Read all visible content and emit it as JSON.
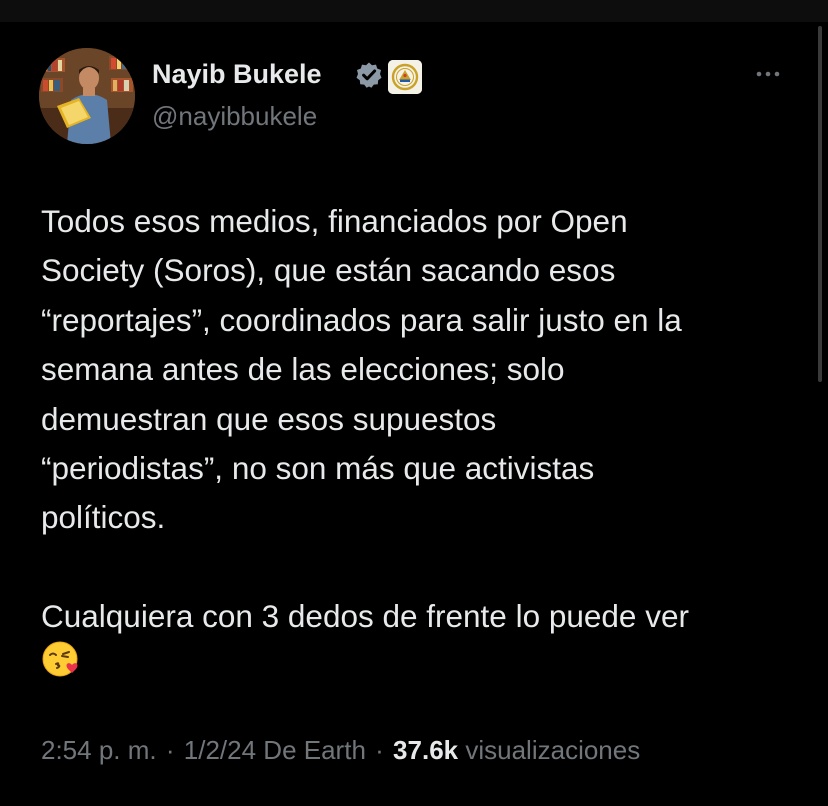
{
  "tweet": {
    "author": {
      "name": "Nayib Bukele",
      "handle": "@nayibbukele",
      "avatar": "avatar-photo",
      "verified_icon": "verified-badge-icon",
      "affiliation_icon": "el-salvador-coat-of-arms-icon"
    },
    "more_icon": "more-options-icon",
    "text": {
      "paragraph_1": "Todos esos medios, financiados por Open\nSociety (Soros), que están sacando esos\n“reportajes”, coordinados para salir justo en la\nsemana antes de las elecciones; solo\ndemuestran que esos supuestos\n“periodistas”, no son más que activistas\npolíticos.",
      "paragraph_2": "Cualquiera con 3 dedos de frente lo puede ver",
      "emoji": "face-blowing-a-kiss-emoji"
    },
    "meta": {
      "time": "2:54 p. m.",
      "date": "1/2/24",
      "source": "De Earth",
      "separator": "·",
      "views_count": "37.6k",
      "views_label": "visualizaciones"
    }
  },
  "colors": {
    "background": "#000000",
    "text_primary": "#e7e9ea",
    "text_secondary": "#71767b",
    "verified_blue": "#1d9bf0"
  }
}
